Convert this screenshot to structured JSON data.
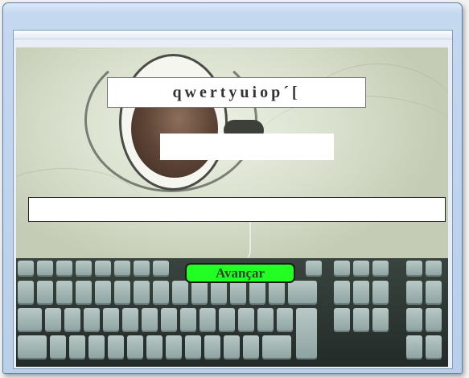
{
  "prompt": {
    "text": "qwertyuiop´["
  },
  "answer_input": {
    "value": ""
  },
  "next_button": {
    "label": "Avançar"
  },
  "colors": {
    "next_button_bg": "#22ff22",
    "window_frame": "#c4d8f0"
  }
}
